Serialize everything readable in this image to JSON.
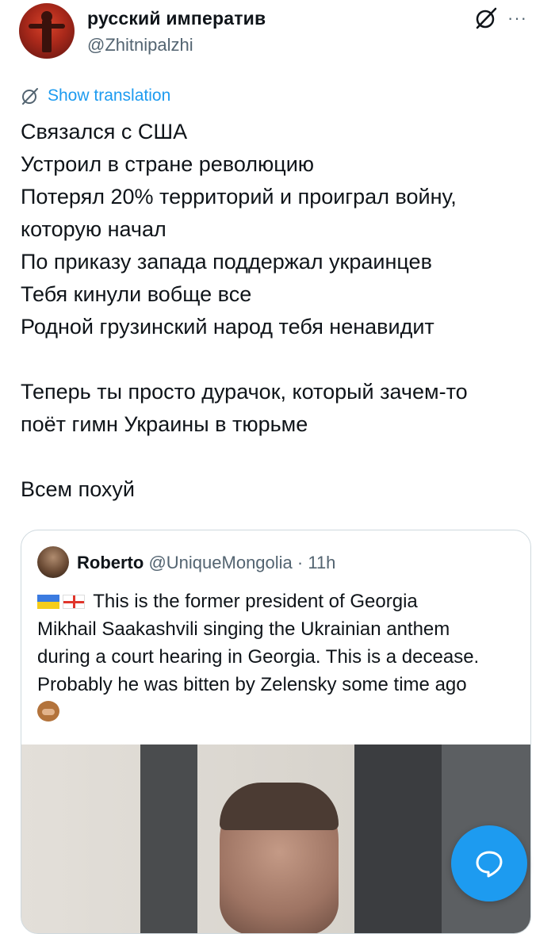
{
  "author": {
    "display_name": "русский императив",
    "handle": "@Zhitnipalzhi"
  },
  "actions": {
    "grok_icon": "grok-icon",
    "more_label": "···"
  },
  "translate": {
    "label": "Show translation"
  },
  "tweet": {
    "lines": [
      "Связался с США",
      "Устроил в стране революцию",
      "Потерял 20% территорий и проиграл войну,",
      "которую начал",
      "По приказу запада поддержал украинцев",
      "Тебя кинули вобще все",
      "Родной грузинский народ тебя ненавидит",
      "",
      "Теперь ты просто дурачок, который зачем-то",
      "поёт гимн Украины в тюрьме",
      "",
      "Всем похуй"
    ]
  },
  "quoted_tweet": {
    "display_name": "Roberto",
    "handle": "@UniqueMongolia",
    "separator": " · ",
    "time": "11h",
    "text_lines": [
      "This is the former president of Georgia",
      "Mikhail Saakashvili singing the Ukrainian anthem",
      "during a court hearing in Georgia. This is a decease.",
      "Probably he was bitten by Zelensky some time ago"
    ]
  },
  "colors": {
    "accent": "#1d9bf0",
    "text": "#0f1419",
    "secondary": "#536471",
    "border": "#cfd9de"
  }
}
